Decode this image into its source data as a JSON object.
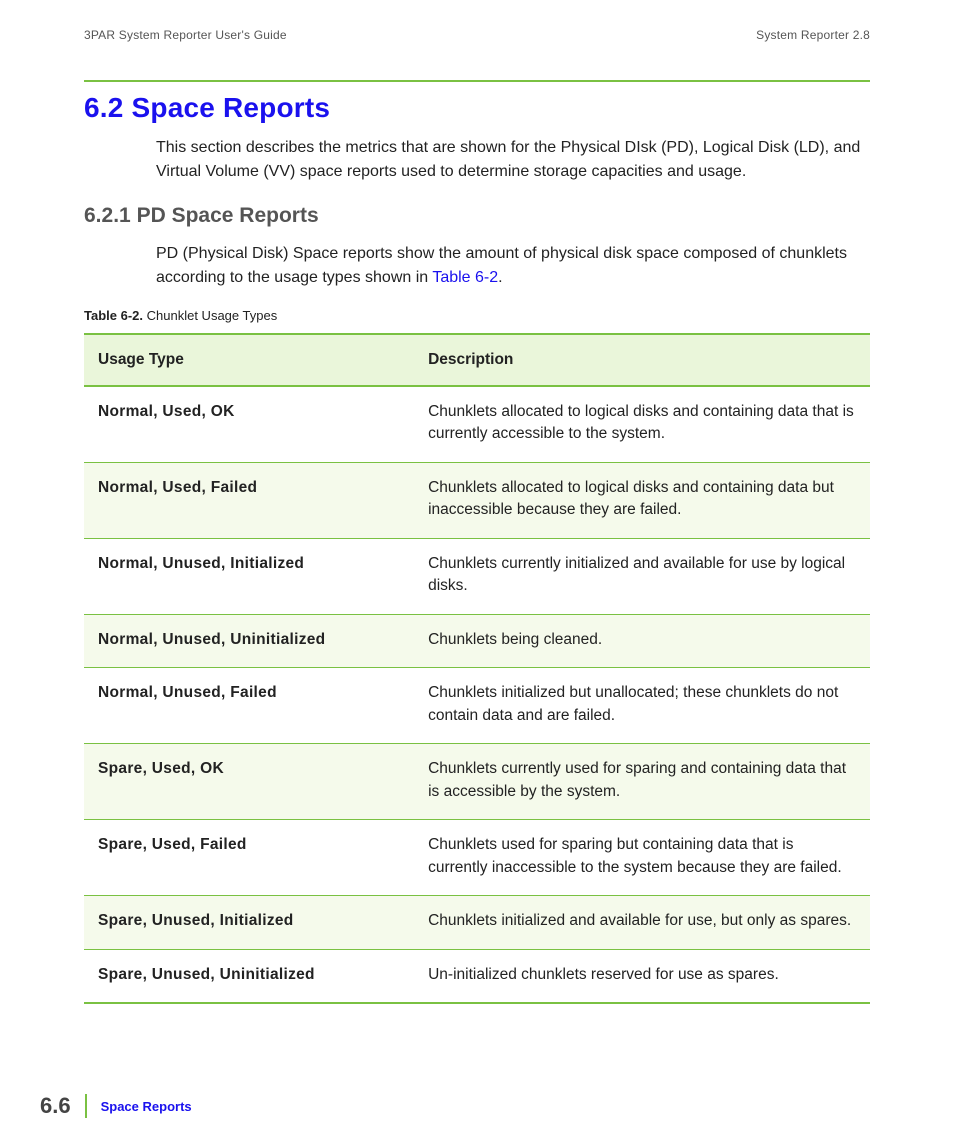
{
  "header": {
    "left": "3PAR System Reporter User's Guide",
    "right": "System Reporter 2.8"
  },
  "section": {
    "number": "6.2",
    "title": "Space Reports",
    "intro": "This section describes the metrics that are shown for the Physical DIsk (PD), Logical Disk (LD), and Virtual Volume (VV) space reports used to determine storage capacities and usage."
  },
  "subsection": {
    "number": "6.2.1",
    "title": "PD Space Reports",
    "para_pre": "PD (Physical Disk) Space reports show the amount of physical disk space composed of chunklets according to the usage types shown in ",
    "para_link": "Table 6-2",
    "para_post": "."
  },
  "table": {
    "caption_number": "Table 6-2.",
    "caption_title": "Chunklet Usage Types",
    "headers": {
      "col1": "Usage Type",
      "col2": "Description"
    },
    "rows": [
      {
        "usage": "Normal, Used, OK",
        "desc": "Chunklets allocated to logical disks and containing data that is currently accessible to the system."
      },
      {
        "usage": "Normal, Used, Failed",
        "desc": "Chunklets allocated to logical disks and containing data but inaccessible because they are failed."
      },
      {
        "usage": "Normal, Unused, Initialized",
        "desc": "Chunklets currently initialized and available for use by logical disks."
      },
      {
        "usage": "Normal, Unused, Uninitialized",
        "desc": "Chunklets being cleaned."
      },
      {
        "usage": "Normal, Unused, Failed",
        "desc": "Chunklets initialized but unallocated; these chunklets do not contain data and are failed."
      },
      {
        "usage": "Spare, Used, OK",
        "desc": "Chunklets currently used for sparing and containing data that is accessible by the system."
      },
      {
        "usage": "Spare, Used, Failed",
        "desc": "Chunklets used for sparing but containing data that is currently inaccessible to the system because they are failed."
      },
      {
        "usage": "Spare, Unused, Initialized",
        "desc": "Chunklets initialized and available for use, but only as spares."
      },
      {
        "usage": "Spare, Unused, Uninitialized",
        "desc": "Un-initialized chunklets reserved for use as spares."
      }
    ]
  },
  "footer": {
    "page": "6.6",
    "label": "Space Reports"
  }
}
